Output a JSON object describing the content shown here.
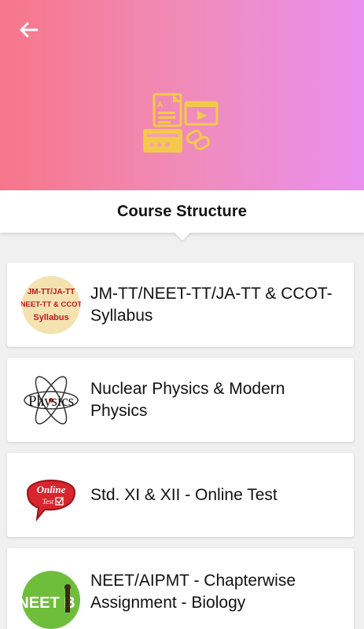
{
  "header": {
    "back_icon": "arrow-left-icon",
    "hero_icon": "course-materials-icon",
    "gradient_start": "#f7768a",
    "gradient_end": "#ea90f0",
    "accent": "#f3c94a"
  },
  "title": "Course Structure",
  "courses": [
    {
      "label": "JM-TT/NEET-TT/JA-TT & CCOT-Syllabus",
      "thumb": {
        "line1": "JM-TT/JA-TT",
        "line2": "NEET-TT & CCOT",
        "line3": "Syllabus"
      }
    },
    {
      "label": "Nuclear Physics & Modern Physics",
      "thumb": {
        "word": "Physics"
      }
    },
    {
      "label": "Std. XI & XII - Online Test",
      "thumb": {
        "line1": "Online",
        "line2": "Test"
      }
    },
    {
      "label": "NEET/AIPMT - Chapterwise Assignment - Biology",
      "thumb": {
        "word": "NEET B"
      }
    }
  ]
}
